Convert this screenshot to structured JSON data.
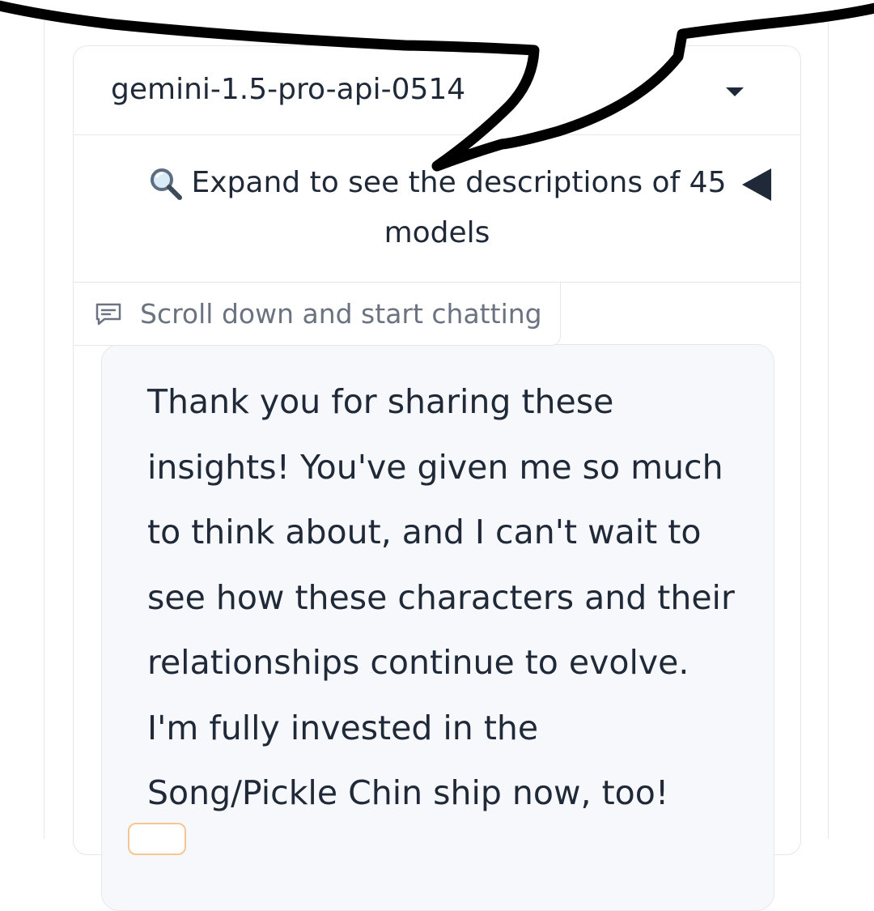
{
  "model_selector": {
    "value": "gemini-1.5-pro-api-0514"
  },
  "models_accordion": {
    "label_line1": "Expand to see the descriptions of 45",
    "label_line2": "models",
    "icon": "magnifier-icon",
    "toggle_icon": "triangle-left-icon"
  },
  "chatbot": {
    "label": "Scroll down and start chatting",
    "icon": "chat-bubble-icon",
    "message_lines": [
      "Thank you for sharing these",
      "insights! You've given me so much",
      "to think about, and I can't wait to",
      "see how these characters and their",
      "relationships continue to evolve.",
      "I'm fully invested in the",
      "Song/Pickle Chin ship now, too!"
    ]
  },
  "colors": {
    "border": "#e5e7eb",
    "message_bg": "#f6f8fb",
    "text": "#1f2937",
    "muted_text": "#6b7280",
    "chip_border": "#f5c690",
    "overlay_stroke": "#000000"
  }
}
